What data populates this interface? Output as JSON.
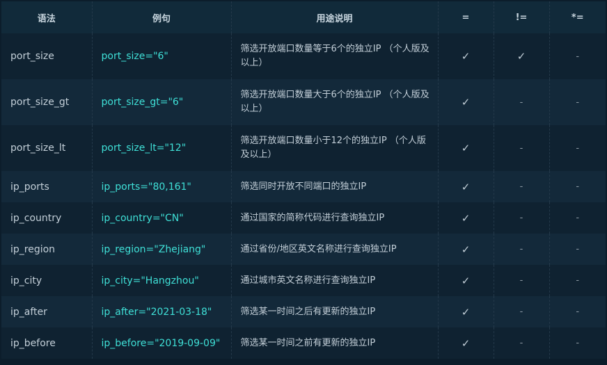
{
  "headers": [
    "语法",
    "例句",
    "用途说明",
    "=",
    "!=",
    "*="
  ],
  "rows": [
    {
      "syntax": "port_size",
      "example": "port_size=\"6\"",
      "desc": "筛选开放端口数量等于6个的独立IP （个人版及以上）",
      "eq": "✓",
      "neq": "✓",
      "like": "-"
    },
    {
      "syntax": "port_size_gt",
      "example": "port_size_gt=\"6\"",
      "desc": "筛选开放端口数量大于6个的独立IP （个人版及以上）",
      "eq": "✓",
      "neq": "-",
      "like": "-"
    },
    {
      "syntax": "port_size_lt",
      "example": "port_size_lt=\"12\"",
      "desc": "筛选开放端口数量小于12个的独立IP （个人版及以上）",
      "eq": "✓",
      "neq": "-",
      "like": "-"
    },
    {
      "syntax": "ip_ports",
      "example": "ip_ports=\"80,161\"",
      "desc": "筛选同时开放不同端口的独立IP",
      "eq": "✓",
      "neq": "-",
      "like": "-"
    },
    {
      "syntax": "ip_country",
      "example": "ip_country=\"CN\"",
      "desc": "通过国家的简称代码进行查询独立IP",
      "eq": "✓",
      "neq": "-",
      "like": "-"
    },
    {
      "syntax": "ip_region",
      "example": "ip_region=\"Zhejiang\"",
      "desc": "通过省份/地区英文名称进行查询独立IP",
      "eq": "✓",
      "neq": "-",
      "like": "-"
    },
    {
      "syntax": "ip_city",
      "example": "ip_city=\"Hangzhou\"",
      "desc": "通过城市英文名称进行查询独立IP",
      "eq": "✓",
      "neq": "-",
      "like": "-"
    },
    {
      "syntax": "ip_after",
      "example": "ip_after=\"2021-03-18\"",
      "desc": "筛选某一时间之后有更新的独立IP",
      "eq": "✓",
      "neq": "-",
      "like": "-"
    },
    {
      "syntax": "ip_before",
      "example": "ip_before=\"2019-09-09\"",
      "desc": "筛选某一时间之前有更新的独立IP",
      "eq": "✓",
      "neq": "-",
      "like": "-"
    }
  ]
}
